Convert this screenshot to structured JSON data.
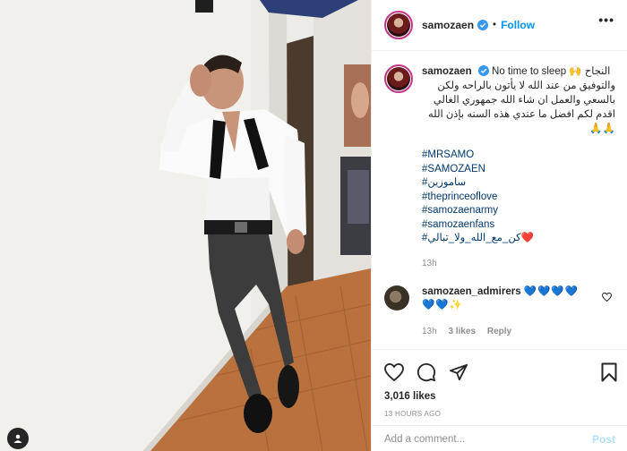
{
  "post": {
    "username": "samozaen",
    "follow_label": "Follow",
    "more_label": "•••",
    "separator": "•"
  },
  "caption": {
    "username": "samozaen",
    "line1": "No time to sleep 🙌 النجاح",
    "arabic": "والتوفيق من عند الله لا يأتون بالراحه ولكن بالسعي والعمل ان شاء الله جمهوري الغالي اقدم لكم افضل ما عندي هذه السنه بإذن الله 🙏🙏",
    "hashtags": [
      "#MRSAMO",
      "#SAMOZAEN",
      "#ساموزين",
      "#theprinceoflove",
      "#samozaenarmy",
      "#samozaenfans",
      "#كن_مع_الله_ولا_تبالي❤️"
    ],
    "time": "13h"
  },
  "comment": {
    "username": "samozaen_admirers",
    "text": "💙💙💙💙💙💙✨",
    "time": "13h",
    "likes": "3 likes",
    "reply_label": "Reply"
  },
  "actions": {
    "likes_count": "3,016 likes",
    "time_ago": "13 HOURS AGO",
    "comment_placeholder": "Add a comment...",
    "post_label": "Post"
  },
  "icons": {
    "header_avatar": "profile-avatar",
    "verified": "verified-badge-icon",
    "like": "heart-icon",
    "comment": "comment-icon",
    "share": "paper-plane-icon",
    "save": "bookmark-icon",
    "tag": "user-tag-icon"
  },
  "colors": {
    "accent_blue": "#0095f6",
    "link_blue": "#00376b",
    "muted": "#8e8e8e",
    "text": "#262626",
    "post_disabled": "#b2dffc"
  }
}
